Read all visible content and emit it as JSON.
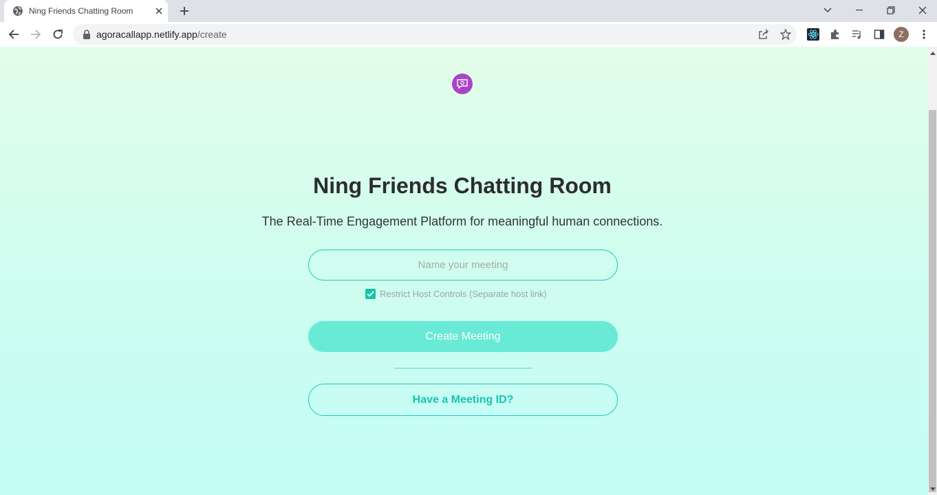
{
  "browser": {
    "tab_title": "Ning Friends Chatting Room",
    "url_host": "agoracallapp.netlify.app",
    "url_path": "/create",
    "profile_initial": "Z"
  },
  "page": {
    "title": "Ning Friends Chatting Room",
    "subtitle": "The Real-Time Engagement Platform for meaningful human connections.",
    "meeting_name_placeholder": "Name your meeting",
    "meeting_name_value": "",
    "restrict_label": "Restrict Host Controls (Separate host link)",
    "restrict_checked": true,
    "create_button": "Create Meeting",
    "join_button": "Have a Meeting ID?"
  },
  "colors": {
    "accent": "#1fc9b7",
    "create_button_bg": "#69ead6",
    "logo_bg": "#a844c8"
  }
}
